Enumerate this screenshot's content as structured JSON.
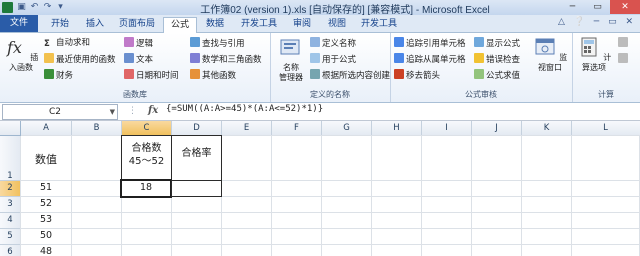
{
  "title_bar": {
    "title": "工作簿02 (version 1).xls [自动保存的] [兼容模式] - Microsoft Excel",
    "app_icon": "X"
  },
  "ribbon_tabs": [
    "文件",
    "开始",
    "插入",
    "页面布局",
    "公式",
    "数据",
    "开发工具",
    "审阅",
    "视图",
    "开发工具"
  ],
  "active_tab": "公式",
  "ribbon": {
    "function_library": {
      "label": "函数库",
      "insert_function": "插入函数",
      "items": [
        "自动求和",
        "最近使用的函数",
        "财务",
        "逻辑",
        "文本",
        "日期和时间",
        "查找与引用",
        "数学和三角函数",
        "其他函数"
      ]
    },
    "defined_names": {
      "label": "定义的名称",
      "name_manager": "名称\n管理器",
      "items": [
        "定义名称",
        "用于公式",
        "根据所选内容创建"
      ]
    },
    "formula_auditing": {
      "label": "公式审核",
      "items": [
        "追踪引用单元格",
        "追踪从属单元格",
        "移去箭头",
        "显示公式",
        "错误检查",
        "公式求值"
      ],
      "watch_window": "监视窗口"
    },
    "calculation": {
      "label": "计算",
      "calc_options": "计算选项"
    }
  },
  "formula_bar": {
    "name_box": "C2",
    "fx": "fx",
    "formula": "{=SUM((A:A>=45)*(A:A<=52)*1)}"
  },
  "sheet": {
    "columns": [
      "A",
      "B",
      "C",
      "D",
      "E",
      "F",
      "G",
      "H",
      "I",
      "J",
      "K",
      "L"
    ],
    "rows": [
      "1",
      "2",
      "3",
      "4",
      "5",
      "6"
    ],
    "cells": {
      "A1": "数值",
      "C1": "合格数\n45～52",
      "D1": "合格率",
      "A2": "51",
      "C2": "18",
      "A3": "52",
      "A4": "53",
      "A5": "50",
      "A6": "48"
    }
  },
  "colors": {
    "file_tab": "#2a5ca8",
    "selection_header": "#f1c15f"
  }
}
